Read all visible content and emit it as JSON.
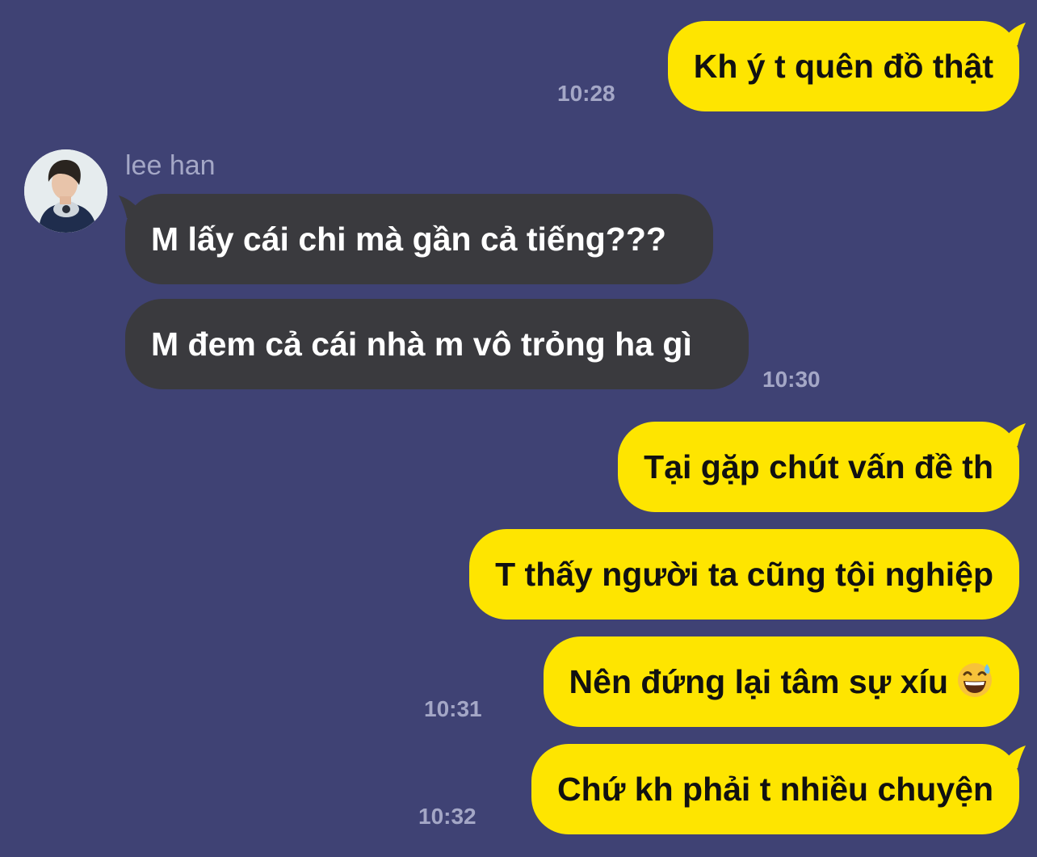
{
  "colors": {
    "background": "#3f4274",
    "outgoing_bubble": "#fee500",
    "incoming_bubble": "#3a3a3e",
    "timestamp": "#a4a7c6"
  },
  "chat": {
    "contact": {
      "name": "lee han",
      "avatar_icon": "profile-photo-avatar"
    },
    "messages": [
      {
        "direction": "outgoing",
        "text": "Kh ý t quên đồ thật",
        "time": "10:28"
      },
      {
        "direction": "incoming",
        "text": "M lấy cái chi mà gần cả tiếng???",
        "time": ""
      },
      {
        "direction": "incoming",
        "text": "M đem cả cái nhà m vô trỏng ha gì",
        "time": "10:30"
      },
      {
        "direction": "outgoing",
        "text": "Tại gặp chút vấn đề th",
        "time": ""
      },
      {
        "direction": "outgoing",
        "text": "T thấy người ta cũng tội nghiệp",
        "time": ""
      },
      {
        "direction": "outgoing",
        "text": "Nên đứng lại tâm sự xíu",
        "emoji": "grinning-face-with-sweat",
        "time": "10:31"
      },
      {
        "direction": "outgoing",
        "text": "Chứ kh phải t nhiều chuyện",
        "time": "10:32"
      }
    ]
  }
}
